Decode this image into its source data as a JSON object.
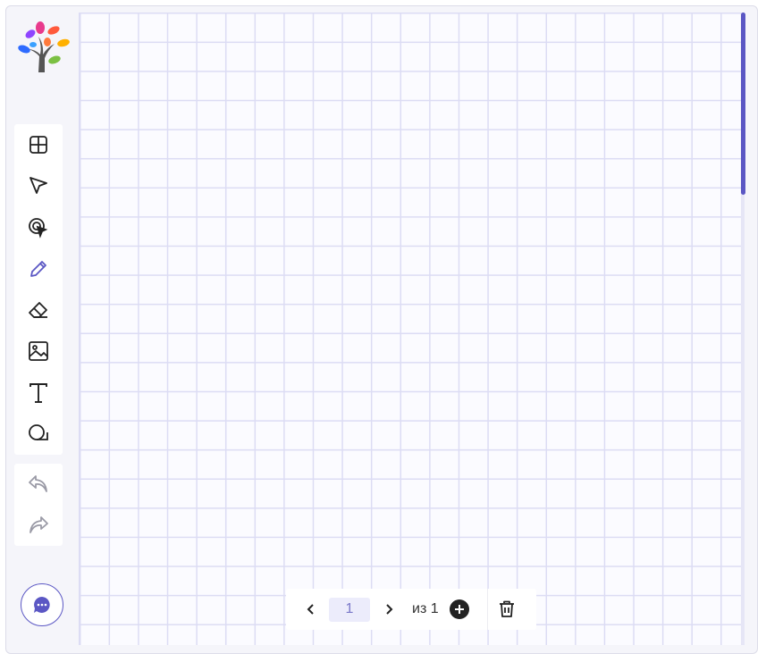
{
  "app": {
    "logo_icon": "tree-logo-icon"
  },
  "toolbar": {
    "active_tool": "pen",
    "accent_color": "#5b57c4",
    "tools": [
      {
        "id": "grid",
        "icon": "grid-icon"
      },
      {
        "id": "select",
        "icon": "cursor-arrow-icon"
      },
      {
        "id": "laser",
        "icon": "laser-pointer-icon"
      },
      {
        "id": "pen",
        "icon": "pencil-icon"
      },
      {
        "id": "eraser",
        "icon": "eraser-icon"
      },
      {
        "id": "image",
        "icon": "image-icon"
      },
      {
        "id": "text",
        "icon": "text-icon"
      },
      {
        "id": "shapes",
        "icon": "shapes-icon"
      }
    ]
  },
  "history": {
    "undo_icon": "undo-icon",
    "redo_icon": "redo-icon"
  },
  "chat": {
    "icon": "chat-bubble-icon"
  },
  "pager": {
    "current_page": "1",
    "of_text": "из 1",
    "prev_icon": "chevron-left-icon",
    "next_icon": "chevron-right-icon",
    "add_icon": "plus-circle-icon",
    "delete_icon": "trash-icon"
  },
  "canvas": {
    "grid_color": "#dcdcf4",
    "background": "#fbfbff"
  }
}
